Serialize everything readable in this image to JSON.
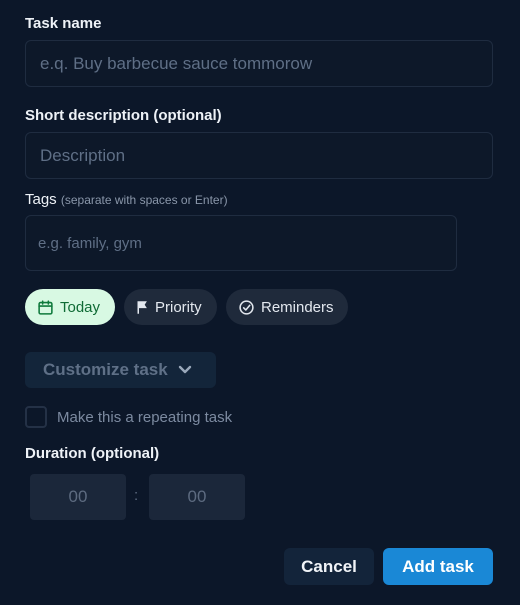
{
  "task_name": {
    "label": "Task name",
    "placeholder": "e.q. Buy barbecue sauce tommorow"
  },
  "description": {
    "label": "Short description (optional)",
    "placeholder": "Description"
  },
  "tags": {
    "label": "Tags",
    "hint": "(separate with spaces or Enter)",
    "placeholder": "e.g. family, gym"
  },
  "chips": {
    "today": "Today",
    "priority": "Priority",
    "reminders": "Reminders"
  },
  "customize": {
    "label": "Customize task"
  },
  "repeating": {
    "label": "Make this a repeating task"
  },
  "duration": {
    "label": "Duration (optional)",
    "hours": "00",
    "separator": ":",
    "minutes": "00"
  },
  "actions": {
    "cancel": "Cancel",
    "add": "Add task"
  },
  "colors": {
    "background": "#0c1729",
    "accent": "#1a88d6",
    "today_chip": "#d8f9e3"
  }
}
